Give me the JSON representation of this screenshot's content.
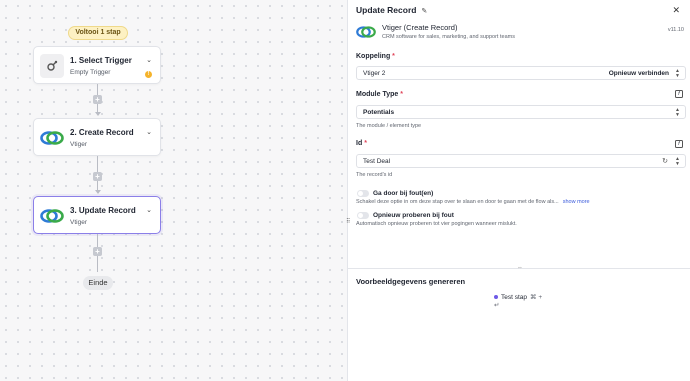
{
  "canvas": {
    "complete_pill": "Voltooi 1 stap",
    "nodes": [
      {
        "title": "1. Select Trigger",
        "subtitle": "Empty Trigger"
      },
      {
        "title": "2. Create Record",
        "subtitle": "Vtiger"
      },
      {
        "title": "3. Update Record",
        "subtitle": "Vtiger"
      }
    ],
    "end_label": "Einde"
  },
  "panel": {
    "title": "Update Record",
    "app": {
      "name": "Vtiger (Create Record)",
      "description": "CRM software for sales, marketing, and support teams",
      "version": "v11.10"
    },
    "fields": {
      "koppeling": {
        "label": "Koppeling",
        "value": "Vtiger 2",
        "action": "Opnieuw verbinden"
      },
      "module_type": {
        "label": "Module Type",
        "value": "Potentials",
        "hint": "The module / element type"
      },
      "id": {
        "label": "Id",
        "value": "Test Deal",
        "hint": "The record's id"
      }
    },
    "toggles": [
      {
        "label": "Ga door bij fout(en)",
        "description": "Schakel deze optie in om deze stap over te slaan en door te gaan met de flow als...",
        "more": "show more"
      },
      {
        "label": "Opnieuw proberen bij fout",
        "description": "Automatisch opnieuw proberen tot vier pogingen wanneer mislukt."
      }
    ],
    "sample": {
      "title": "Voorbeeldgegevens genereren",
      "test_step": "Test stap",
      "shortcut": "⌘ + ↵"
    }
  },
  "colors": {
    "accent": "#8b7fe8",
    "warning": "#f5b32b",
    "link": "#3b5bdb",
    "required": "#e0455a"
  }
}
